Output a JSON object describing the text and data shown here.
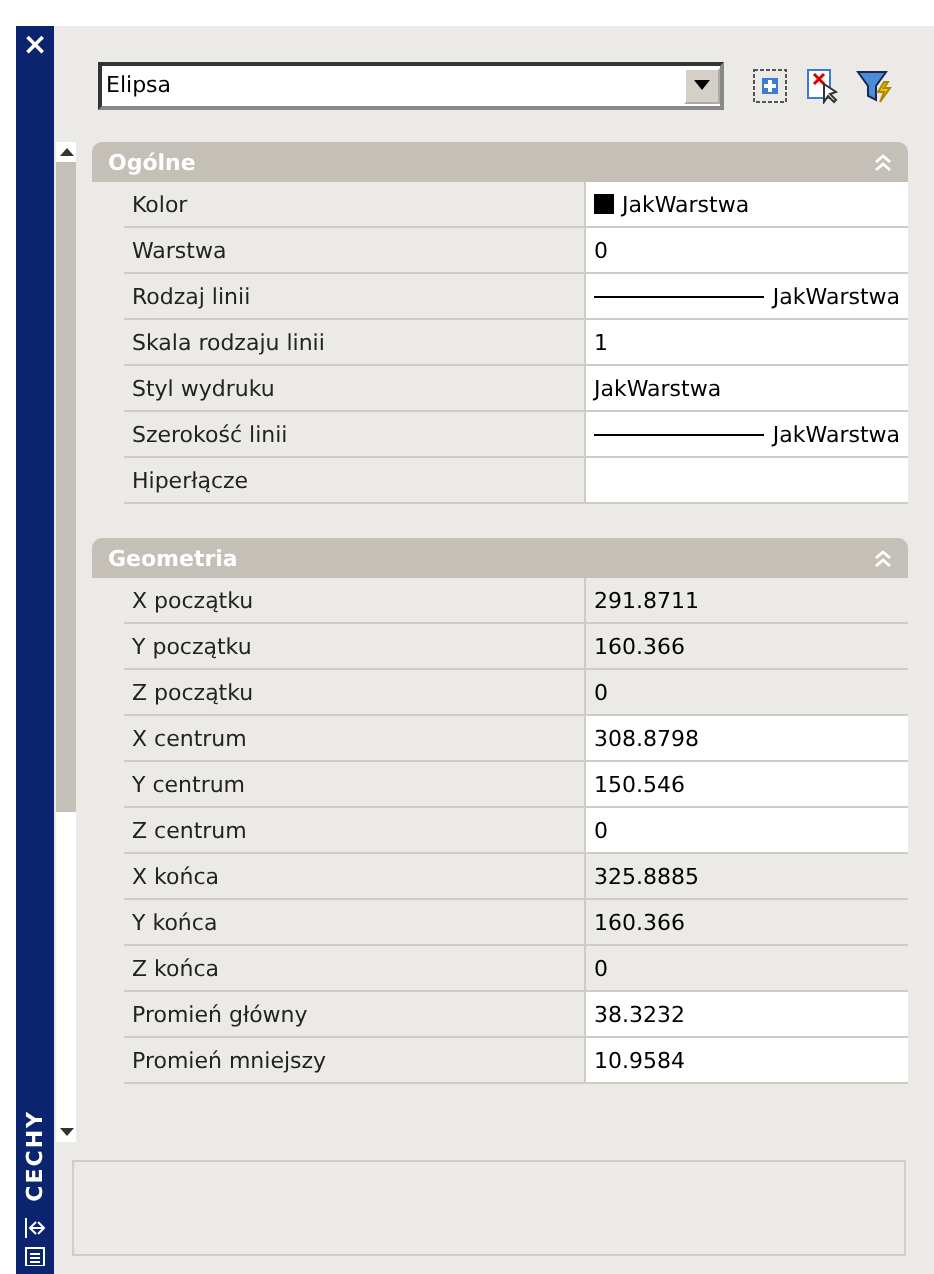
{
  "palette": {
    "close": "×",
    "title": "CECHY"
  },
  "object_select": {
    "value": "Elipsa"
  },
  "sections": [
    {
      "title": "Ogólne",
      "expanded": true,
      "rows": [
        {
          "label": "Kolor",
          "kind": "color",
          "value": "JakWarstwa",
          "readonly": false
        },
        {
          "label": "Warstwa",
          "kind": "text",
          "value": "0",
          "readonly": false
        },
        {
          "label": "Rodzaj linii",
          "kind": "linetype",
          "value": "JakWarstwa",
          "readonly": false
        },
        {
          "label": "Skala rodzaju linii",
          "kind": "text",
          "value": "1",
          "readonly": false
        },
        {
          "label": "Styl wydruku",
          "kind": "text",
          "value": "JakWarstwa",
          "readonly": false
        },
        {
          "label": "Szerokość linii",
          "kind": "linetype",
          "value": "JakWarstwa",
          "readonly": false
        },
        {
          "label": "Hiperłącze",
          "kind": "text",
          "value": "",
          "readonly": false
        }
      ]
    },
    {
      "title": "Geometria",
      "expanded": true,
      "rows": [
        {
          "label": "X początku",
          "kind": "text",
          "value": "291.8711",
          "readonly": true
        },
        {
          "label": "Y początku",
          "kind": "text",
          "value": "160.366",
          "readonly": true
        },
        {
          "label": "Z początku",
          "kind": "text",
          "value": "0",
          "readonly": true
        },
        {
          "label": "X centrum",
          "kind": "text",
          "value": "308.8798",
          "readonly": false
        },
        {
          "label": "Y centrum",
          "kind": "text",
          "value": "150.546",
          "readonly": false
        },
        {
          "label": "Z centrum",
          "kind": "text",
          "value": "0",
          "readonly": false
        },
        {
          "label": "X końca",
          "kind": "text",
          "value": "325.8885",
          "readonly": true
        },
        {
          "label": "Y końca",
          "kind": "text",
          "value": "160.366",
          "readonly": true
        },
        {
          "label": "Z końca",
          "kind": "text",
          "value": "0",
          "readonly": true
        },
        {
          "label": "Promień główny",
          "kind": "text",
          "value": "38.3232",
          "readonly": false
        },
        {
          "label": "Promień mniejszy",
          "kind": "text",
          "value": "10.9584",
          "readonly": false
        }
      ]
    }
  ]
}
